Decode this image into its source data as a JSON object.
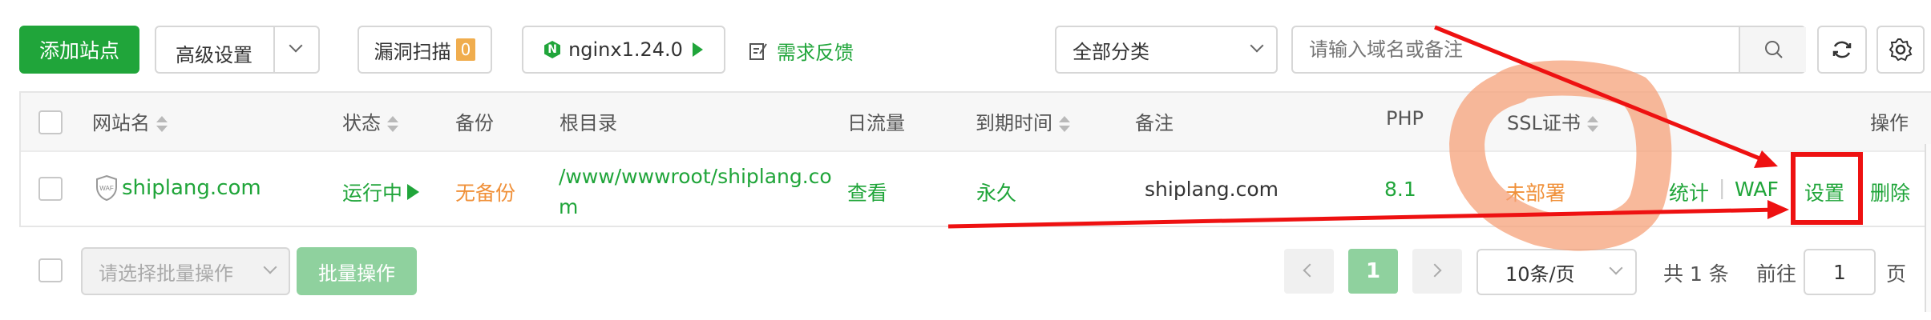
{
  "toolbar": {
    "add_site": "添加站点",
    "advanced": "高级设置",
    "vuln_scan": "漏洞扫描",
    "vuln_count": "0",
    "nginx": "nginx1.24.0",
    "feedback": "需求反馈",
    "category": "全部分类",
    "search_placeholder": "请输入域名或备注"
  },
  "table": {
    "headers": {
      "name": "网站名",
      "status": "状态",
      "backup": "备份",
      "root": "根目录",
      "traffic": "日流量",
      "expire": "到期时间",
      "note": "备注",
      "php": "PHP",
      "ssl": "SSL证书",
      "ops": "操作"
    },
    "row": {
      "name": "shiplang.com",
      "waf_badge": "WAF",
      "status": "运行中",
      "backup": "无备份",
      "root_line1": "/www/wwwroot/shiplang.co",
      "root_line2": "m",
      "traffic": "查看",
      "expire": "永久",
      "note": "shiplang.com",
      "php": "8.1",
      "ssl": "未部署",
      "op_stats": "统计",
      "op_sep": "|",
      "op_waf": "WAF",
      "op_settings": "设置",
      "op_delete": "删除"
    }
  },
  "footer": {
    "batch_placeholder": "请选择批量操作",
    "batch_button": "批量操作",
    "current_page": "1",
    "page_size": "10条/页",
    "total": "共 1 条",
    "goto_label": "前往",
    "goto_value": "1",
    "page_label": "页"
  },
  "colors": {
    "accent": "#20a53a",
    "warning": "#f0913a",
    "annotation": "#ee1111",
    "highlight": "#f5a27a"
  }
}
